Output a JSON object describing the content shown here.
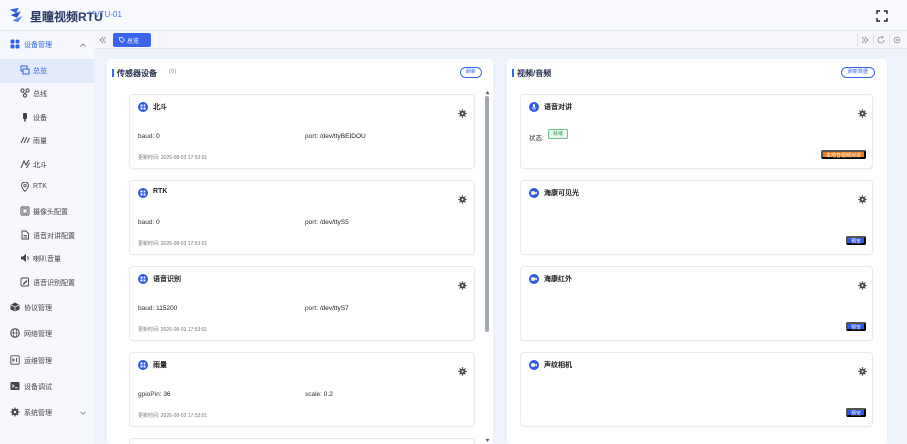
{
  "header": {
    "brand": "星瞳视频RTU",
    "device": "YVTU-01"
  },
  "sidebar": {
    "groups": [
      {
        "label": "设备管理",
        "icon": "grid-icon",
        "open": true
      },
      {
        "label": "协议管理",
        "icon": "cube-icon"
      },
      {
        "label": "网络管理",
        "icon": "globe-icon"
      },
      {
        "label": "运维管理",
        "icon": "tools-icon"
      },
      {
        "label": "设备调试",
        "icon": "terminal-icon"
      },
      {
        "label": "系统管理",
        "icon": "gear-icon"
      }
    ],
    "sub_items": [
      {
        "label": "总览",
        "icon": "overview-icon",
        "active": true
      },
      {
        "label": "总线",
        "icon": "bus-icon"
      },
      {
        "label": "设备",
        "icon": "device-icon"
      },
      {
        "label": "雨量",
        "icon": "rain-icon"
      },
      {
        "label": "北斗",
        "icon": "satellite-icon"
      },
      {
        "label": "RTK",
        "icon": "location-pin-icon"
      },
      {
        "label": "摄像头配置",
        "icon": "camera-config-icon"
      },
      {
        "label": "语音对讲配置",
        "icon": "intercom-config-icon"
      },
      {
        "label": "喇叭音量",
        "icon": "speaker-icon"
      },
      {
        "label": "语音识别配置",
        "icon": "voice-recognition-config-icon"
      }
    ]
  },
  "tabs": {
    "active_label": "总览"
  },
  "sensors": {
    "title": "传感器设备",
    "count": "(6)",
    "refresh_label": "刷新",
    "update_prefix": "更新时间:",
    "cards": [
      {
        "name": "北斗",
        "k1": "baud:",
        "v1": "0",
        "k2": "port:",
        "v2": "/dev/ttyBEIDOU",
        "updated": "2026-08-03 17:53:01"
      },
      {
        "name": "RTK",
        "k1": "baud:",
        "v1": "0",
        "k2": "port:",
        "v2": "/dev/ttyS5",
        "updated": "2026-08-03 17:53:01"
      },
      {
        "name": "语音识别",
        "k1": "baud:",
        "v1": "115200",
        "k2": "port:",
        "v2": "/dev/ttyS7",
        "updated": "2026-08-03 17:53:01"
      },
      {
        "name": "雨量",
        "k1": "gpioPin:",
        "v1": "36",
        "k2": "scale:",
        "v2": "0.2",
        "updated": "2026-08-03 17:53:01"
      }
    ]
  },
  "media": {
    "title": "视频/音频",
    "refresh_label": "刷新数据",
    "intercom": {
      "name": "语音对讲",
      "status_label": "状态:",
      "status_value": "就绪",
      "action_label": "本地音视频对讲"
    },
    "cameras": [
      {
        "name": "海康可见光",
        "action_label": "预览"
      },
      {
        "name": "海康红外",
        "action_label": "预览"
      },
      {
        "name": "声纹相机",
        "action_label": "预览"
      }
    ]
  },
  "colors": {
    "accent": "#3a64ee",
    "orange": "#f07a18",
    "ready_green": "#2f9a55"
  }
}
